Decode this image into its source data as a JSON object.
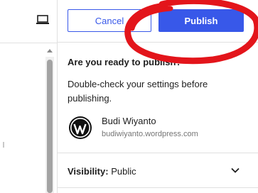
{
  "header": {
    "cancel_label": "Cancel",
    "publish_label": "Publish"
  },
  "prepublish": {
    "heading": "Are you ready to publish?",
    "description": "Double-check your settings before publishing.",
    "site_name": "Budi Wiyanto",
    "site_url": "budiwiyanto.wordpress.com"
  },
  "visibility": {
    "label": "Visibility:",
    "value": "Public"
  },
  "icons": {
    "device": "desktop-preview-icon",
    "site_logo": "wordpress-logo-icon",
    "toggle": "chevron-down-icon"
  },
  "colors": {
    "accent": "#3858e9",
    "annotation": "#e3151b"
  }
}
